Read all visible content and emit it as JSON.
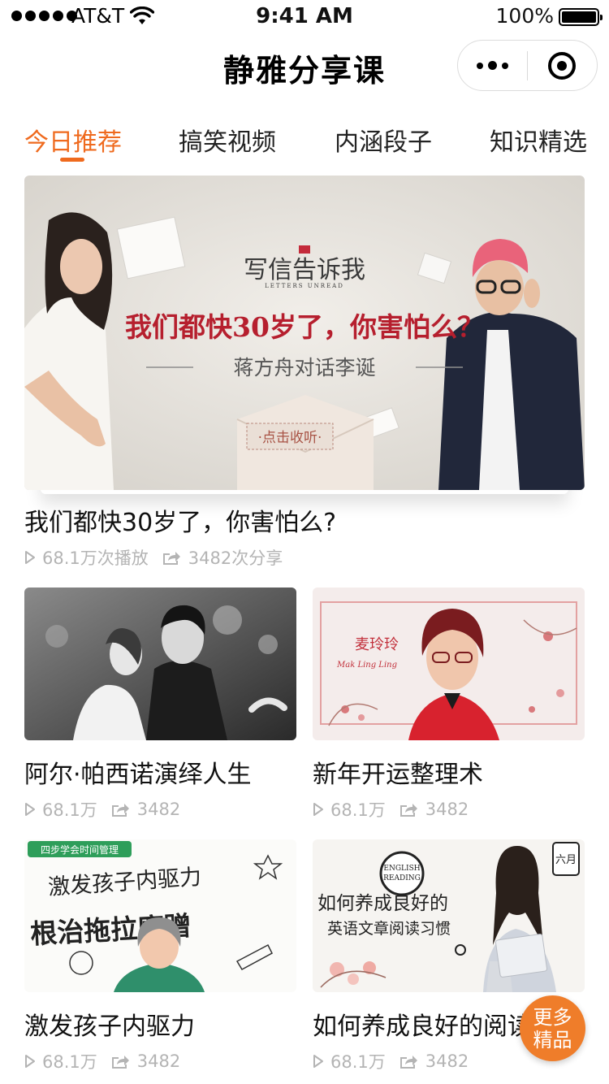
{
  "status_bar": {
    "carrier": "AT&T",
    "time": "9:41 AM",
    "battery_percent": "100%",
    "battery_level": 1.0
  },
  "nav": {
    "title": "静雅分享课"
  },
  "tabs": [
    {
      "label": "今日推荐",
      "active": true
    },
    {
      "label": "搞笑视频",
      "active": false
    },
    {
      "label": "内涵段子",
      "active": false
    },
    {
      "label": "知识精选",
      "active": false
    }
  ],
  "featured": {
    "banner": {
      "brand": "写信告诉我",
      "brand_en": "LETTERS UNREAD",
      "headline": "我们都快30岁了，你害怕么？",
      "subtitle": "蒋方舟对话李诞",
      "cta": "·点击收听·"
    },
    "title": "我们都快30岁了，你害怕么?",
    "plays": "68.1万次播放",
    "shares": "3482次分享"
  },
  "grid": [
    {
      "title": "阿尔·帕西诺演绎人生",
      "plays": "68.1万",
      "shares": "3482"
    },
    {
      "title": "新年开运整理术",
      "plays": "68.1万",
      "shares": "3482",
      "thumb": {
        "name": "麦玲玲",
        "name_en": "Mak Ling Ling"
      }
    },
    {
      "title": "激发孩子内驱力",
      "plays": "68.1万",
      "shares": "3482",
      "thumb": {
        "badge": "四步学会时间管理",
        "line1": "激发孩子内驱力",
        "line2": "根治拖拉磨蹭"
      }
    },
    {
      "title": "如何养成良好的阅读",
      "plays": "68.1万",
      "shares": "3482",
      "thumb": {
        "en_line1": "ENGLISH",
        "en_line2": "READING",
        "line1": "如何养成良好的",
        "line2": "英语文章阅读习惯",
        "month": "六月"
      }
    }
  ],
  "fab": {
    "line1": "更多",
    "line2": "精品"
  },
  "colors": {
    "accent": "#ef6a1e",
    "meta_gray": "#b4b4b4",
    "fab": "#ef7d2a"
  }
}
